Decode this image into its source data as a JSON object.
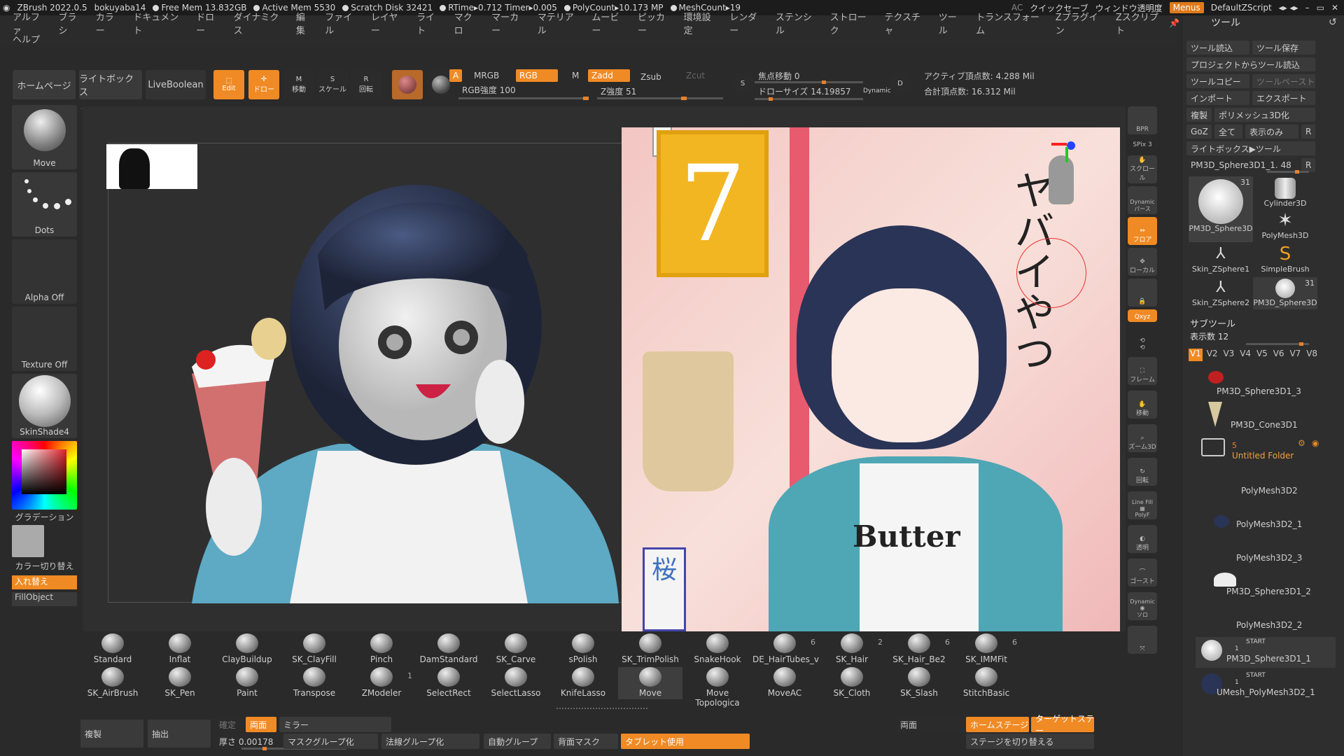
{
  "titlebar": {
    "app": "ZBrush 2022.0.5",
    "user": "bokuyaba14",
    "free_mem": "Free Mem 13.832GB",
    "active_mem": "Active Mem 5530",
    "scratch": "Scratch Disk 32421",
    "rtime": "RTime▸0.712 Timer▸0.005",
    "polycount": "PolyCount▸10.173 MP",
    "meshcount": "MeshCount▸19",
    "ac": "AC",
    "quicksave": "クイックセーブ",
    "window_transparency": "ウィンドウ透明度",
    "menus": "Menus",
    "defaultzscript": "DefaultZScript"
  },
  "menubar": {
    "items": [
      "アルファ",
      "ブラシ",
      "カラー",
      "ドキュメント",
      "ドロー",
      "ダイナミクス",
      "編集",
      "ファイル",
      "レイヤー",
      "ライト",
      "マクロ",
      "マーカー",
      "マテリアル",
      "ムービー",
      "ピッカー",
      "環境設定",
      "レンダー",
      "ステンシル",
      "ストローク",
      "テクスチャ",
      "ツール",
      "トランスフォーム",
      "Zプラグイン",
      "Zスクリプト"
    ],
    "help": "ヘルプ"
  },
  "shelf": {
    "homepage": "ホームページ",
    "lightbox": "ライトボックス",
    "liveboolean": "LiveBoolean",
    "edit": "Edit",
    "draw": "ドロー",
    "move": "移動",
    "scale": "スケール",
    "rotate": "回転",
    "a": "A",
    "mrgb": "MRGB",
    "rgb": "RGB",
    "m": "M",
    "zadd": "Zadd",
    "zsub": "Zsub",
    "zcut": "Zcut",
    "rgb_intensity": "RGB強度 100",
    "z_intensity": "Z強度 51",
    "focal_shift": "焦点移動 0",
    "draw_size": "ドローサイズ 14.19857",
    "dynamic": "Dynamic",
    "active_points": "アクティブ頂点数: 4.288 Mil",
    "total_points": "合計頂点数: 16.312 Mil",
    "rgb_value": 0.9,
    "z_value": 0.51,
    "focal_value": 0.5,
    "drawsize_value": 0.2
  },
  "leftpanel": {
    "brush": "Move",
    "stroke": "Dots",
    "alpha": "Alpha Off",
    "texture": "Texture Off",
    "material": "SkinShade4",
    "gradient": "グラデーション",
    "switch_color": "カラー切り替え",
    "swap": "入れ替え",
    "fillobject": "FillObject"
  },
  "rightstrip": {
    "bpr": "BPR",
    "spix": "SPix 3",
    "scroll": "スクロール",
    "dynamic": "Dynamic",
    "perspective": "パース",
    "floor": "フロア",
    "local": "ローカル",
    "xyz": "Qxyz",
    "frame": "フレーム",
    "move": "移動",
    "zoom3d": "ズーム3D",
    "rotate": "回転",
    "linefill": "Line Fill",
    "polyf": "PolyF",
    "transp": "透明",
    "ghost": "ゴースト",
    "solo": "ソロ",
    "dynamic2": "Dynamic"
  },
  "toolpanel": {
    "title": "ツール",
    "load_tool": "ツール読込",
    "save_tool": "ツール保存",
    "load_from_project": "プロジェクトからツール読込",
    "copy_tool": "ツールコピー",
    "paste_tool": "ツールペースト",
    "import": "インポート",
    "export": "エクスポート",
    "clone": "複製",
    "make_polymesh": "ポリメッシュ3D化",
    "goz": "GoZ",
    "all": "全て",
    "visible": "表示のみ",
    "r": "R",
    "lightbox_tool": "ライトボックス▶ツール",
    "current_tool": "PM3D_Sphere3D1_1. 48",
    "thumbs": [
      {
        "name": "PM3D_Sphere3D",
        "count": "31"
      },
      {
        "name": "Cylinder3D",
        "count": ""
      },
      {
        "name": "PolyMesh3D",
        "count": ""
      },
      {
        "name": "Skin_ZSphere1",
        "count": ""
      },
      {
        "name": "SimpleBrush",
        "count": ""
      },
      {
        "name": "Skin_ZSphere2",
        "count": ""
      },
      {
        "name": "PM3D_Sphere3D",
        "count": "31"
      }
    ],
    "subtool_title": "サブツール",
    "visible_count": "表示数 12",
    "versions": [
      "V1",
      "V2",
      "V3",
      "V4",
      "V5",
      "V6",
      "V7",
      "V8"
    ],
    "subtools": [
      "PM3D_Sphere3D1_3",
      "PM3D_Cone3D1",
      "Untitled Folder",
      "PolyMesh3D2",
      "PolyMesh3D2_1",
      "PolyMesh3D2_3",
      "PM3D_Sphere3D1_2",
      "PolyMesh3D2_2",
      "PM3D_Sphere3D1_1",
      "UMesh_PolyMesh3D2_1"
    ],
    "folder_count": "5",
    "start": "START",
    "one": "1"
  },
  "brushes": {
    "row1": [
      {
        "name": "Standard",
        "count": ""
      },
      {
        "name": "Inflat",
        "count": ""
      },
      {
        "name": "ClayBuildup",
        "count": ""
      },
      {
        "name": "SK_ClayFill",
        "count": ""
      },
      {
        "name": "Pinch",
        "count": ""
      },
      {
        "name": "DamStandard",
        "count": ""
      },
      {
        "name": "SK_Carve",
        "count": ""
      },
      {
        "name": "sPolish",
        "count": ""
      },
      {
        "name": "SK_TrimPolish",
        "count": ""
      },
      {
        "name": "SnakeHook",
        "count": ""
      },
      {
        "name": "DE_HairTubes_v",
        "count": "6"
      },
      {
        "name": "SK_Hair",
        "count": "2"
      },
      {
        "name": "SK_Hair_Be2",
        "count": "6"
      },
      {
        "name": "SK_IMMFit",
        "count": "6"
      }
    ],
    "row2": [
      {
        "name": "SK_AirBrush",
        "count": ""
      },
      {
        "name": "SK_Pen",
        "count": ""
      },
      {
        "name": "Paint",
        "count": ""
      },
      {
        "name": "Transpose",
        "count": ""
      },
      {
        "name": "ZModeler",
        "count": "1"
      },
      {
        "name": "SelectRect",
        "count": ""
      },
      {
        "name": "SelectLasso",
        "count": ""
      },
      {
        "name": "KnifeLasso",
        "count": ""
      },
      {
        "name": "Move",
        "count": ""
      },
      {
        "name": "Move Topologica",
        "count": ""
      },
      {
        "name": "MoveAC",
        "count": ""
      },
      {
        "name": "SK_Cloth",
        "count": ""
      },
      {
        "name": "SK_Slash",
        "count": ""
      },
      {
        "name": "StitchBasic",
        "count": ""
      }
    ]
  },
  "bottombar": {
    "clone": "複製",
    "extract": "抽出",
    "confirm": "確定",
    "both_sides": "両面",
    "mirror": "ミラー",
    "thickness": "厚さ 0.00178",
    "mask_group": "マスクグループ化",
    "poly_group": "法線グループ化",
    "auto_group": "自動グループ",
    "back_mask": "背面マスク",
    "tablet": "タブレット使用",
    "both2": "両面",
    "home_stage": "ホームステージ",
    "target_stage": "ターゲットステー",
    "switch_stage": "ステージを切り替える"
  },
  "reference": {
    "number": "7",
    "vertical_text": "ヤバイやつ",
    "shirt_text": "Butter",
    "sign": "桜"
  },
  "colors": {
    "accent": "#f08a24",
    "bg": "#2b2b2b"
  }
}
